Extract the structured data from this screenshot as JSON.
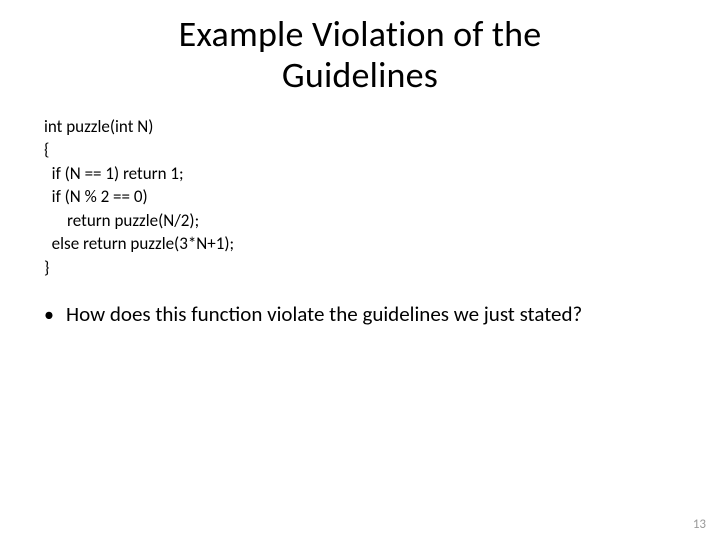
{
  "title_line1": "Example Violation of the",
  "title_line2": "Guidelines",
  "code": {
    "l0": "int puzzle(int N)",
    "l1": "{",
    "l2": "  if (N == 1) return 1;",
    "l3": "  if (N % 2 == 0)",
    "l4": "      return puzzle(N/2);",
    "l5": "  else return puzzle(3*N+1);",
    "l6": "}"
  },
  "bullet": {
    "marker": "•",
    "text": "How does this function violate the guidelines we just stated?"
  },
  "page_number": "13"
}
